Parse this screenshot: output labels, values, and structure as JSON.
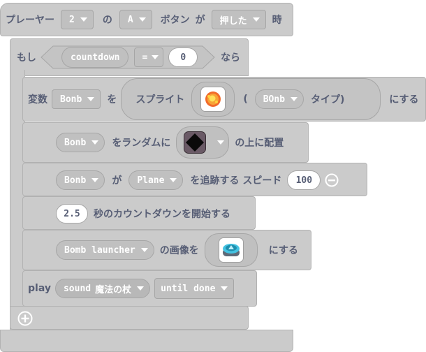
{
  "hat": {
    "prefix": "プレーヤー",
    "player": "2",
    "no": "の",
    "button": "A",
    "button_word": "ボタン",
    "ga": "が",
    "action": "押した",
    "suffix": "時"
  },
  "if_block": {
    "moshi": "もし",
    "variable": "countdown",
    "operator": "=",
    "value": "0",
    "nara": "なら"
  },
  "set_sprite": {
    "label": "変数",
    "variable": "Bonb",
    "wo": "を",
    "sprite_label": "スプライト",
    "sprite_icon": "fire-burst-icon",
    "paren_open": "(",
    "kind": "BOnb",
    "kind_suffix": "タイプ)",
    "suffix": "にする"
  },
  "random_place": {
    "sprite": "Bonb",
    "label": "をランダムに",
    "tile_icon": "dark-tile-icon",
    "suffix": "の上に配置"
  },
  "follow": {
    "sprite": "Bonb",
    "ga": "が",
    "target": "Plane",
    "label": "を追跡する スピード",
    "speed": "100",
    "remove_icon": "minus-circle-icon"
  },
  "countdown": {
    "seconds": "2.5",
    "label": "秒のカウントダウンを開始する"
  },
  "set_image": {
    "sprite": "Bomb launcher",
    "label": "の画像を",
    "image_icon": "launcher-button-icon",
    "suffix": "にする"
  },
  "play": {
    "label": "play",
    "sound_label": "sound",
    "sound_name": "魔法の杖",
    "mode": "until done"
  },
  "add_icon": "plus-circle-icon"
}
